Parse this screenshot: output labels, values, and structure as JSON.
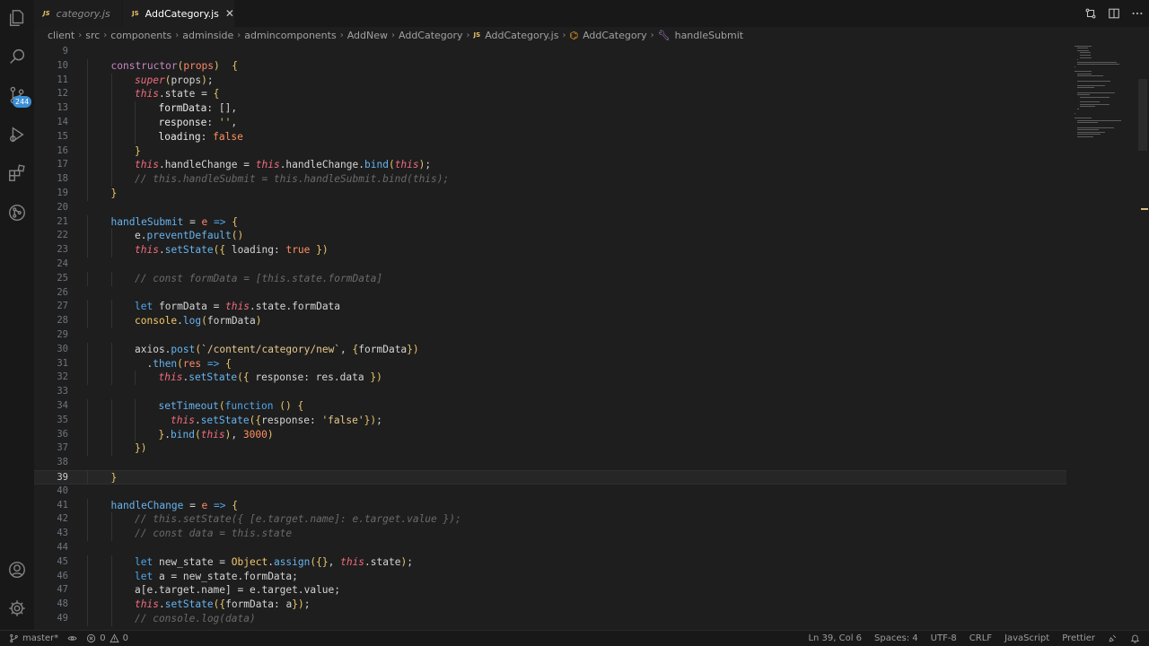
{
  "activity_bar": {
    "items": [
      {
        "name": "explorer-icon"
      },
      {
        "name": "search-icon"
      },
      {
        "name": "source-control-icon",
        "badge": "244"
      },
      {
        "name": "run-debug-icon"
      },
      {
        "name": "extensions-icon"
      },
      {
        "name": "git-graph-icon"
      }
    ],
    "bottom": [
      {
        "name": "account-icon"
      },
      {
        "name": "settings-gear-icon"
      }
    ]
  },
  "tabs": [
    {
      "label": "category.js",
      "icon": "JS",
      "active": false
    },
    {
      "label": "AddCategory.js",
      "icon": "JS",
      "active": true,
      "close": "✕"
    }
  ],
  "breadcrumb": {
    "folders": [
      "client",
      "src",
      "components",
      "adminside",
      "admincomponents",
      "AddNew",
      "AddCategory"
    ],
    "file": "AddCategory.js",
    "file_icon": "JS",
    "class_name": "AddCategory",
    "method": "handleSubmit"
  },
  "editor": {
    "current_line": 39,
    "lines": [
      {
        "n": "9",
        "indent": 0,
        "tokens": []
      },
      {
        "n": "10",
        "indent": 1,
        "tokens": [
          [
            "t-key",
            "constructor"
          ],
          [
            "t-br",
            "("
          ],
          [
            "t-param",
            "props"
          ],
          [
            "t-br",
            ")"
          ],
          [
            "",
            "  "
          ],
          [
            "t-br",
            "{"
          ]
        ]
      },
      {
        "n": "11",
        "indent": 2,
        "tokens": [
          [
            "t-self",
            "super"
          ],
          [
            "t-br",
            "("
          ],
          [
            "",
            "props"
          ],
          [
            "t-br",
            ")"
          ],
          [
            "",
            ";"
          ]
        ]
      },
      {
        "n": "12",
        "indent": 2,
        "tokens": [
          [
            "t-self",
            "this"
          ],
          [
            "",
            ".state = "
          ],
          [
            "t-br",
            "{"
          ]
        ]
      },
      {
        "n": "13",
        "indent": 3,
        "tokens": [
          [
            "t-prop",
            "formData"
          ],
          [
            "",
            ": []"
          ],
          [
            "",
            ","
          ]
        ]
      },
      {
        "n": "14",
        "indent": 3,
        "tokens": [
          [
            "t-prop",
            "response"
          ],
          [
            "",
            ": "
          ],
          [
            "t-str",
            "''"
          ],
          [
            "",
            ","
          ]
        ]
      },
      {
        "n": "15",
        "indent": 3,
        "tokens": [
          [
            "t-prop",
            "loading"
          ],
          [
            "",
            ": "
          ],
          [
            "t-bool",
            "false"
          ]
        ]
      },
      {
        "n": "16",
        "indent": 2,
        "tokens": [
          [
            "t-br",
            "}"
          ]
        ]
      },
      {
        "n": "17",
        "indent": 2,
        "tokens": [
          [
            "t-self",
            "this"
          ],
          [
            "",
            ".handleChange = "
          ],
          [
            "t-self",
            "this"
          ],
          [
            "",
            ".handleChange."
          ],
          [
            "t-fn",
            "bind"
          ],
          [
            "t-br",
            "("
          ],
          [
            "t-self",
            "this"
          ],
          [
            "t-br",
            ")"
          ],
          [
            "",
            ";"
          ]
        ]
      },
      {
        "n": "18",
        "indent": 2,
        "tokens": [
          [
            "t-com",
            "// this.handleSubmit = this.handleSubmit.bind(this);"
          ]
        ]
      },
      {
        "n": "19",
        "indent": 1,
        "tokens": [
          [
            "t-br",
            "}"
          ]
        ]
      },
      {
        "n": "20",
        "indent": 0,
        "tokens": []
      },
      {
        "n": "21",
        "indent": 1,
        "tokens": [
          [
            "t-fn",
            "handleSubmit"
          ],
          [
            "",
            " = "
          ],
          [
            "t-param",
            "e"
          ],
          [
            "",
            " "
          ],
          [
            "t-stor",
            "=>"
          ],
          [
            "",
            " "
          ],
          [
            "t-br",
            "{"
          ]
        ]
      },
      {
        "n": "22",
        "indent": 2,
        "tokens": [
          [
            "",
            "e."
          ],
          [
            "t-fn",
            "preventDefault"
          ],
          [
            "t-br",
            "()"
          ]
        ]
      },
      {
        "n": "23",
        "indent": 2,
        "tokens": [
          [
            "t-self",
            "this"
          ],
          [
            "",
            "."
          ],
          [
            "t-fn",
            "setState"
          ],
          [
            "t-br",
            "("
          ],
          [
            "t-br",
            "{"
          ],
          [
            "",
            " loading: "
          ],
          [
            "t-bool",
            "true"
          ],
          [
            "",
            " "
          ],
          [
            "t-br",
            "}"
          ],
          [
            "t-br",
            ")"
          ]
        ]
      },
      {
        "n": "24",
        "indent": 0,
        "tokens": []
      },
      {
        "n": "25",
        "indent": 2,
        "tokens": [
          [
            "t-com",
            "// const formData = [this.state.formData]"
          ]
        ]
      },
      {
        "n": "26",
        "indent": 0,
        "tokens": []
      },
      {
        "n": "27",
        "indent": 2,
        "tokens": [
          [
            "t-stor",
            "let"
          ],
          [
            "",
            " formData = "
          ],
          [
            "t-self",
            "this"
          ],
          [
            "",
            ".state.formData"
          ]
        ]
      },
      {
        "n": "28",
        "indent": 2,
        "tokens": [
          [
            "t-cls",
            "console"
          ],
          [
            "",
            "."
          ],
          [
            "t-fn",
            "log"
          ],
          [
            "t-br",
            "("
          ],
          [
            "",
            "formData"
          ],
          [
            "t-br",
            ")"
          ]
        ]
      },
      {
        "n": "29",
        "indent": 0,
        "tokens": []
      },
      {
        "n": "30",
        "indent": 2,
        "tokens": [
          [
            "",
            "axios."
          ],
          [
            "t-fn",
            "post"
          ],
          [
            "t-br",
            "("
          ],
          [
            "t-str",
            "`/content/category/new`"
          ],
          [
            "",
            ", "
          ],
          [
            "t-br",
            "{"
          ],
          [
            "",
            "formData"
          ],
          [
            "t-br",
            "}"
          ],
          [
            "t-br",
            ")"
          ]
        ]
      },
      {
        "n": "31",
        "indent": 2,
        "tokens": [
          [
            "",
            "  ."
          ],
          [
            "t-fn",
            "then"
          ],
          [
            "t-br",
            "("
          ],
          [
            "t-param",
            "res"
          ],
          [
            "",
            " "
          ],
          [
            "t-stor",
            "=>"
          ],
          [
            "",
            " "
          ],
          [
            "t-br",
            "{"
          ]
        ]
      },
      {
        "n": "32",
        "indent": 3,
        "tokens": [
          [
            "t-self",
            "this"
          ],
          [
            "",
            "."
          ],
          [
            "t-fn",
            "setState"
          ],
          [
            "t-br",
            "("
          ],
          [
            "t-br",
            "{"
          ],
          [
            "",
            " response: res.data "
          ],
          [
            "t-br",
            "}"
          ],
          [
            "t-br",
            ")"
          ]
        ]
      },
      {
        "n": "33",
        "indent": 0,
        "tokens": []
      },
      {
        "n": "34",
        "indent": 3,
        "tokens": [
          [
            "t-fn",
            "setTimeout"
          ],
          [
            "t-br",
            "("
          ],
          [
            "t-stor",
            "function"
          ],
          [
            "",
            " "
          ],
          [
            "t-br",
            "()"
          ],
          [
            "",
            " "
          ],
          [
            "t-br",
            "{"
          ]
        ]
      },
      {
        "n": "35",
        "indent": 3,
        "tokens": [
          [
            "",
            "  "
          ],
          [
            "t-self",
            "this"
          ],
          [
            "",
            "."
          ],
          [
            "t-fn",
            "setState"
          ],
          [
            "t-br",
            "("
          ],
          [
            "t-br",
            "{"
          ],
          [
            "",
            "response: "
          ],
          [
            "t-str",
            "'false'"
          ],
          [
            "t-br",
            "}"
          ],
          [
            "t-br",
            ")"
          ],
          [
            "",
            ";"
          ]
        ]
      },
      {
        "n": "36",
        "indent": 3,
        "tokens": [
          [
            "t-br",
            "}"
          ],
          [
            "",
            "."
          ],
          [
            "t-fn",
            "bind"
          ],
          [
            "t-br",
            "("
          ],
          [
            "t-self",
            "this"
          ],
          [
            "t-br",
            ")"
          ],
          [
            "",
            ", "
          ],
          [
            "t-num",
            "3000"
          ],
          [
            "t-br",
            ")"
          ]
        ]
      },
      {
        "n": "37",
        "indent": 2,
        "tokens": [
          [
            "t-br",
            "})"
          ]
        ]
      },
      {
        "n": "38",
        "indent": 0,
        "tokens": []
      },
      {
        "n": "39",
        "indent": 1,
        "tokens": [
          [
            "t-br",
            "}"
          ]
        ]
      },
      {
        "n": "40",
        "indent": 0,
        "tokens": []
      },
      {
        "n": "41",
        "indent": 1,
        "tokens": [
          [
            "t-fn",
            "handleChange"
          ],
          [
            "",
            " = "
          ],
          [
            "t-param",
            "e"
          ],
          [
            "",
            " "
          ],
          [
            "t-stor",
            "=>"
          ],
          [
            "",
            " "
          ],
          [
            "t-br",
            "{"
          ]
        ]
      },
      {
        "n": "42",
        "indent": 2,
        "tokens": [
          [
            "t-com",
            "// this.setState({ [e.target.name]: e.target.value });"
          ]
        ]
      },
      {
        "n": "43",
        "indent": 2,
        "tokens": [
          [
            "t-com",
            "// const data = this.state"
          ]
        ]
      },
      {
        "n": "44",
        "indent": 0,
        "tokens": []
      },
      {
        "n": "45",
        "indent": 2,
        "tokens": [
          [
            "t-stor",
            "let"
          ],
          [
            "",
            " new_state = "
          ],
          [
            "t-cls",
            "Object"
          ],
          [
            "",
            "."
          ],
          [
            "t-fn",
            "assign"
          ],
          [
            "t-br",
            "("
          ],
          [
            "t-br",
            "{}"
          ],
          [
            "",
            ", "
          ],
          [
            "t-self",
            "this"
          ],
          [
            "",
            ".state"
          ],
          [
            "t-br",
            ")"
          ],
          [
            "",
            ";"
          ]
        ]
      },
      {
        "n": "46",
        "indent": 2,
        "tokens": [
          [
            "t-stor",
            "let"
          ],
          [
            "",
            " a = new_state.formData;"
          ]
        ]
      },
      {
        "n": "47",
        "indent": 2,
        "tokens": [
          [
            "",
            "a[e.target.name] = e.target.value;"
          ]
        ]
      },
      {
        "n": "48",
        "indent": 2,
        "tokens": [
          [
            "t-self",
            "this"
          ],
          [
            "",
            "."
          ],
          [
            "t-fn",
            "setState"
          ],
          [
            "t-br",
            "("
          ],
          [
            "t-br",
            "{"
          ],
          [
            "",
            "formData: a"
          ],
          [
            "t-br",
            "}"
          ],
          [
            "t-br",
            ")"
          ],
          [
            "",
            ";"
          ]
        ]
      },
      {
        "n": "49",
        "indent": 2,
        "tokens": [
          [
            "t-com",
            "// console.log(data)"
          ]
        ]
      }
    ]
  },
  "status_bar": {
    "branch": "master*",
    "errors": "0",
    "warnings": "0",
    "position": "Ln 39, Col 6",
    "spaces": "Spaces: 4",
    "encoding": "UTF-8",
    "eol": "CRLF",
    "language": "JavaScript",
    "formatter": "Prettier"
  }
}
